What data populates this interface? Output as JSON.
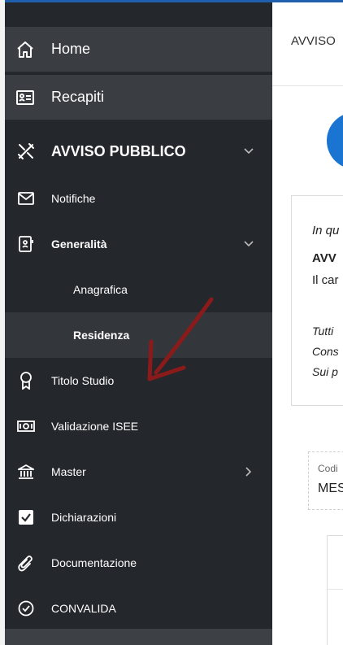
{
  "sidebar": {
    "home": "Home",
    "recapiti": "Recapiti",
    "avviso": "AVVISO PUBBLICO",
    "notifiche": "Notifiche",
    "generalita": "Generalità",
    "anagrafica": "Anagrafica",
    "residenza": "Residenza",
    "titolo_studio": "Titolo Studio",
    "validazione_isee": "Validazione ISEE",
    "master": "Master",
    "dichiarazioni": "Dichiarazioni",
    "documentazione": "Documentazione",
    "convalida": "CONVALIDA"
  },
  "main": {
    "breadcrumb": "AVVISO",
    "card_lines": [
      "In qu",
      "AVV",
      "Il car",
      "Tutti",
      "Cons",
      "Sui p"
    ],
    "codice_label": "Codi",
    "codice_value": "MES"
  },
  "colors": {
    "sidebar_bg": "#24272b",
    "top_item_bg": "#3a3e42",
    "active_bg": "#33373c",
    "accent_blue": "#1a75d2",
    "annotation_arrow": "#8b1a1a"
  }
}
